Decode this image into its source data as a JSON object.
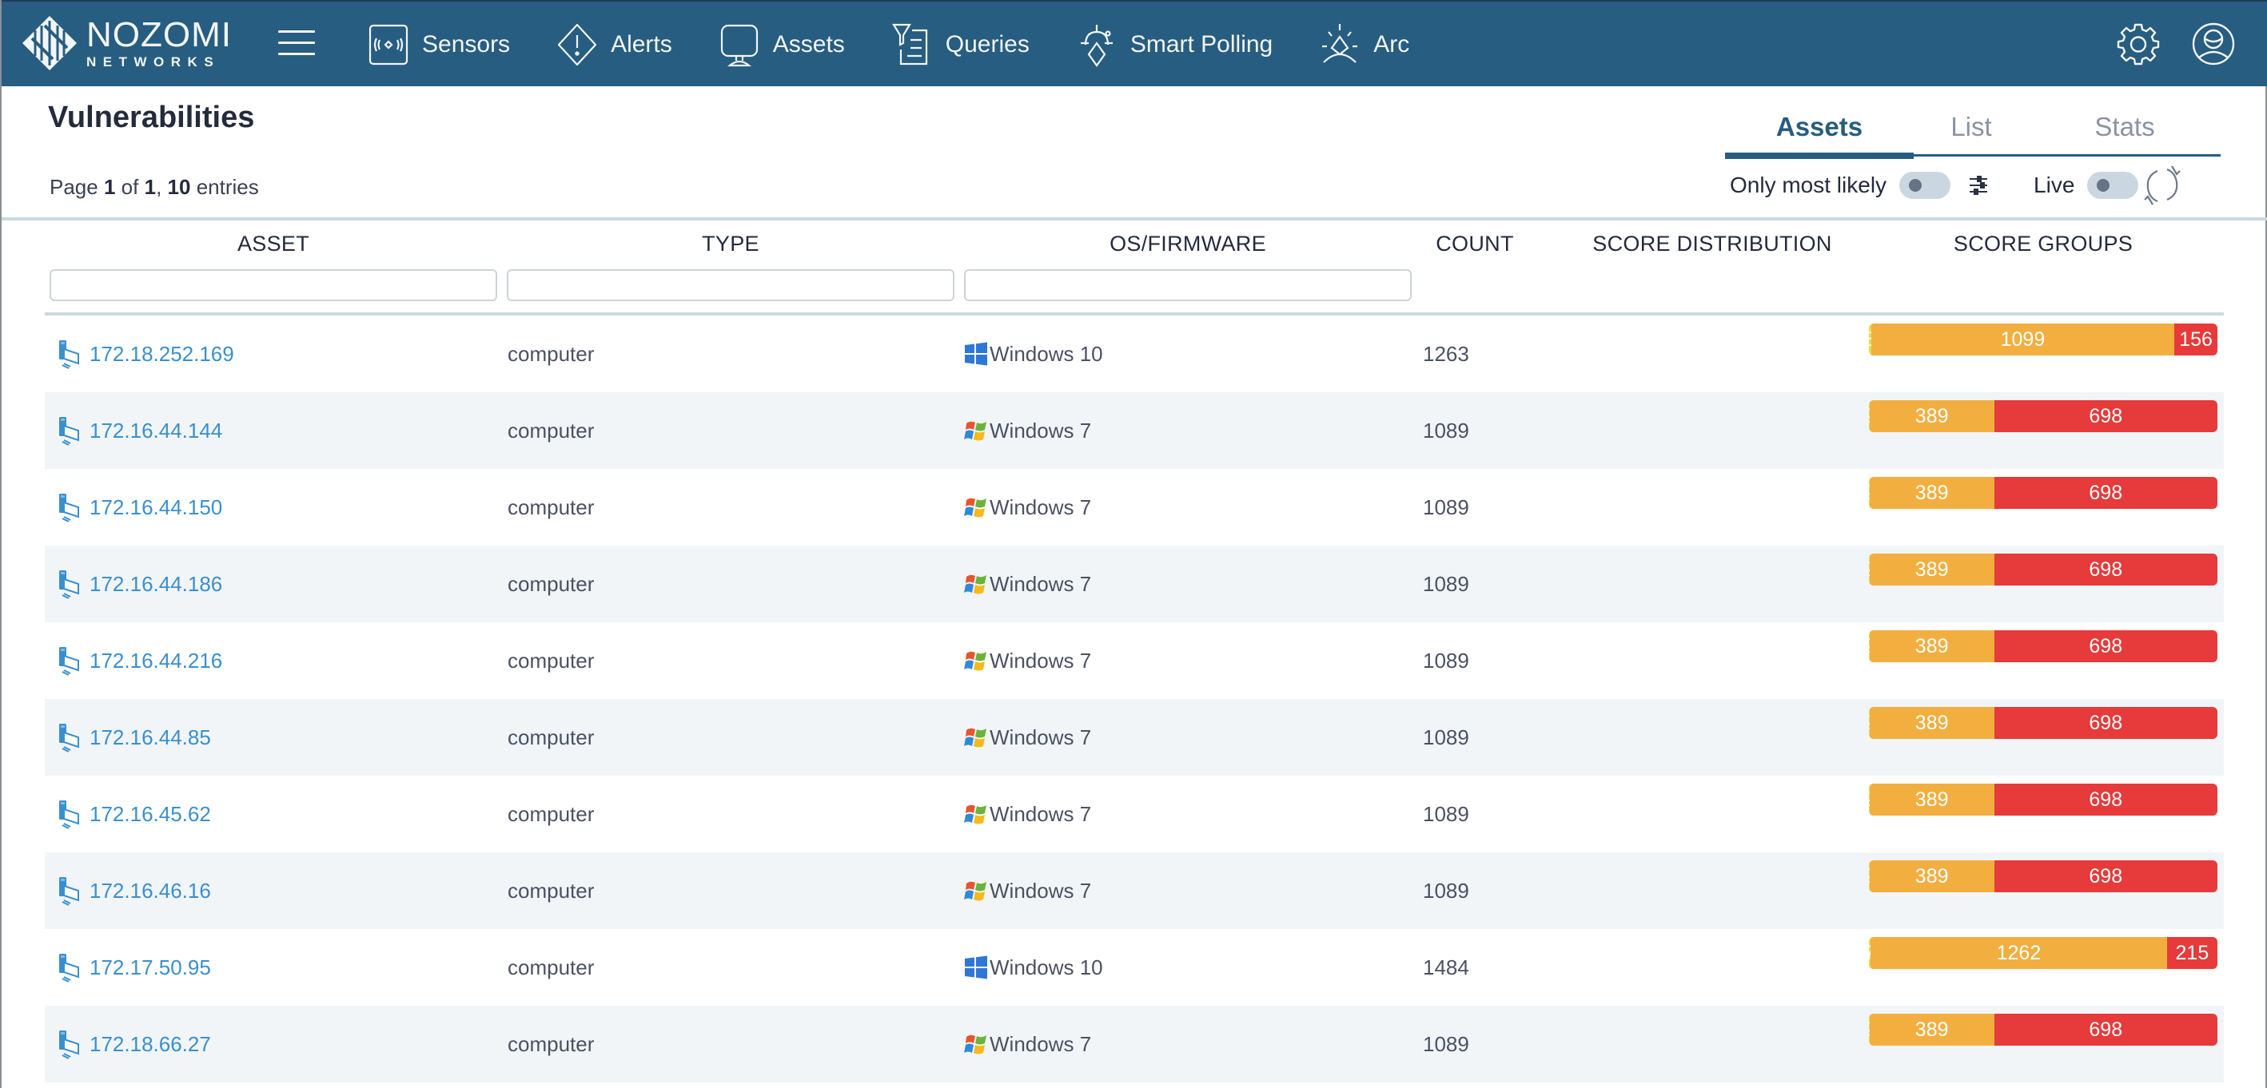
{
  "app": {
    "brand_line1": "NOZOMI",
    "brand_line2": "NETWORKS"
  },
  "nav": {
    "items": [
      {
        "label": "Sensors",
        "icon": "sensors-icon"
      },
      {
        "label": "Alerts",
        "icon": "alert-diamond-icon"
      },
      {
        "label": "Assets",
        "icon": "monitor-icon"
      },
      {
        "label": "Queries",
        "icon": "queries-filter-icon"
      },
      {
        "label": "Smart Polling",
        "icon": "smart-polling-icon"
      },
      {
        "label": "Arc",
        "icon": "arc-icon"
      }
    ],
    "right_icons": [
      "gear-icon",
      "user-icon"
    ]
  },
  "page": {
    "title": "Vulnerabilities",
    "pager": {
      "prefix": "Page",
      "current": "1",
      "of": "of",
      "total": "1",
      "sep": ",",
      "entries": "10",
      "entries_label": "entries"
    }
  },
  "tabs": [
    {
      "label": "Assets",
      "active": true
    },
    {
      "label": "List",
      "active": false
    },
    {
      "label": "Stats",
      "active": false
    }
  ],
  "controls": {
    "only_most_likely_label": "Only most likely",
    "only_most_likely_on": false,
    "live_label": "Live",
    "live_on": false
  },
  "table": {
    "columns": [
      "ASSET",
      "TYPE",
      "OS/FIRMWARE",
      "COUNT",
      "SCORE DISTRIBUTION",
      "SCORE GROUPS"
    ],
    "filters": {
      "asset": "",
      "type": "",
      "os": ""
    },
    "colors": {
      "low": "#eadc3b",
      "medium": "#f2af40",
      "high": "#e73a3a",
      "link": "#3a8fcf"
    },
    "rows": [
      {
        "asset": "172.18.252.169",
        "type": "computer",
        "os": "Windows 10",
        "os_icon": "windows10-icon",
        "count": "1263",
        "groups": {
          "low": 8,
          "medium": 1099,
          "high": 156
        }
      },
      {
        "asset": "172.16.44.144",
        "type": "computer",
        "os": "Windows 7",
        "os_icon": "windows7-icon",
        "count": "1089",
        "groups": {
          "low": 2,
          "medium": 389,
          "high": 698
        }
      },
      {
        "asset": "172.16.44.150",
        "type": "computer",
        "os": "Windows 7",
        "os_icon": "windows7-icon",
        "count": "1089",
        "groups": {
          "low": 2,
          "medium": 389,
          "high": 698
        }
      },
      {
        "asset": "172.16.44.186",
        "type": "computer",
        "os": "Windows 7",
        "os_icon": "windows7-icon",
        "count": "1089",
        "groups": {
          "low": 2,
          "medium": 389,
          "high": 698
        }
      },
      {
        "asset": "172.16.44.216",
        "type": "computer",
        "os": "Windows 7",
        "os_icon": "windows7-icon",
        "count": "1089",
        "groups": {
          "low": 2,
          "medium": 389,
          "high": 698
        }
      },
      {
        "asset": "172.16.44.85",
        "type": "computer",
        "os": "Windows 7",
        "os_icon": "windows7-icon",
        "count": "1089",
        "groups": {
          "low": 2,
          "medium": 389,
          "high": 698
        }
      },
      {
        "asset": "172.16.45.62",
        "type": "computer",
        "os": "Windows 7",
        "os_icon": "windows7-icon",
        "count": "1089",
        "groups": {
          "low": 2,
          "medium": 389,
          "high": 698
        }
      },
      {
        "asset": "172.16.46.16",
        "type": "computer",
        "os": "Windows 7",
        "os_icon": "windows7-icon",
        "count": "1089",
        "groups": {
          "low": 2,
          "medium": 389,
          "high": 698
        }
      },
      {
        "asset": "172.17.50.95",
        "type": "computer",
        "os": "Windows 10",
        "os_icon": "windows10-icon",
        "count": "1484",
        "groups": {
          "low": 7,
          "medium": 1262,
          "high": 215
        }
      },
      {
        "asset": "172.18.66.27",
        "type": "computer",
        "os": "Windows 7",
        "os_icon": "windows7-icon",
        "count": "1089",
        "groups": {
          "low": 2,
          "medium": 389,
          "high": 698
        }
      }
    ]
  }
}
